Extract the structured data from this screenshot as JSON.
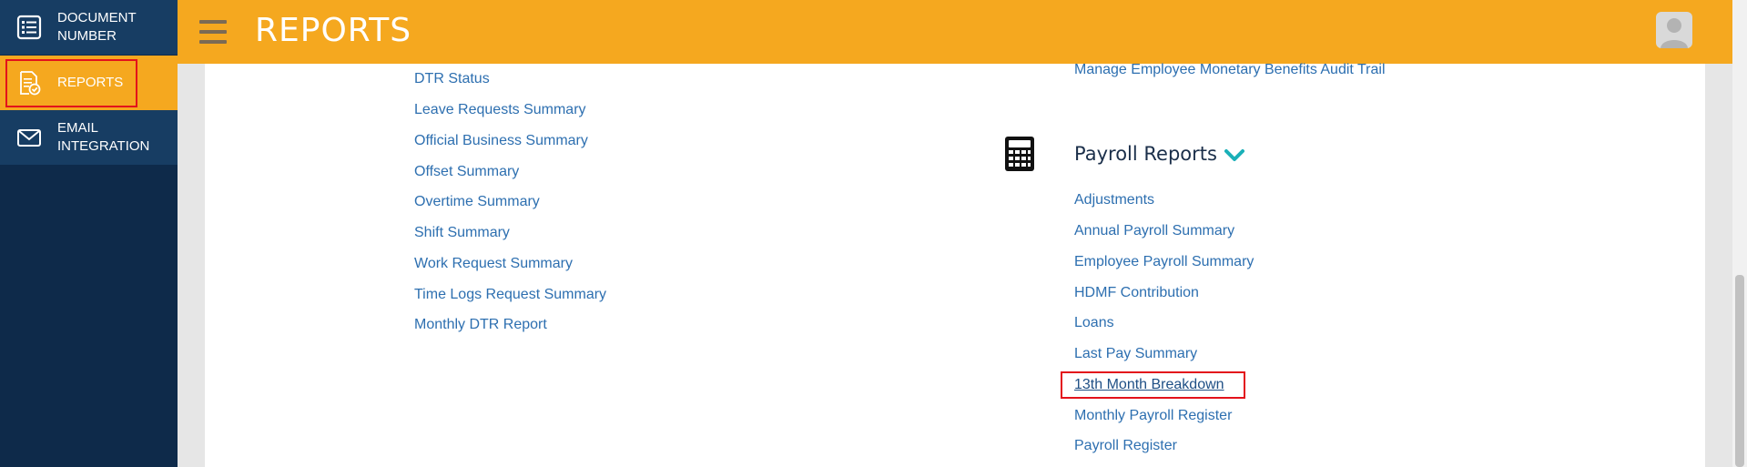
{
  "sidebar": {
    "items": [
      {
        "label": "Document Number",
        "icon": "list-document-icon"
      },
      {
        "label": "Reports",
        "icon": "report-check-icon"
      },
      {
        "label": "Email Integration",
        "icon": "envelope-icon"
      }
    ]
  },
  "header": {
    "title": "REPORTS",
    "menu_icon": "hamburger-menu-icon",
    "avatar_icon": "user-avatar-icon"
  },
  "left_reports": [
    "DTR Status",
    "Leave Requests Summary",
    "Official Business Summary",
    "Offset Summary",
    "Overtime Summary",
    "Shift Summary",
    "Work Request Summary",
    "Time Logs Request Summary",
    "Monthly DTR Report"
  ],
  "benefits_reports": {
    "items": [
      "Manage Employee Monetary Benefits Audit Trail"
    ]
  },
  "payroll_reports": {
    "title": "Payroll Reports",
    "icon": "calculator-icon",
    "toggle_icon": "chevron-down-icon",
    "items": [
      "Adjustments",
      "Annual Payroll Summary",
      "Employee Payroll Summary",
      "HDMF Contribution",
      "Loans",
      "Last Pay Summary",
      "13th Month Breakdown",
      "Monthly Payroll Register",
      "Payroll Register"
    ]
  },
  "colors": {
    "sidebar_bg": "#0e2a4a",
    "sidebar_item_bg": "#173d63",
    "accent": "#f5a81f",
    "link": "#2d6fb0",
    "highlight": "#e3121b"
  }
}
